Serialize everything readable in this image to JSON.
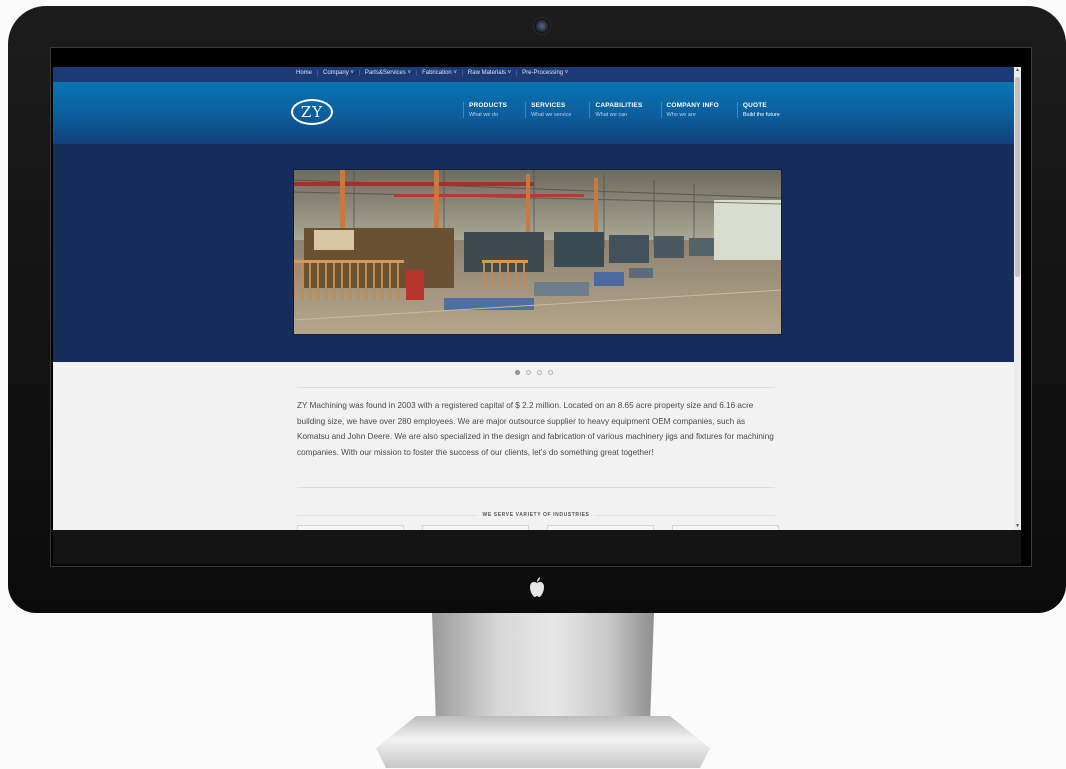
{
  "utility_nav": {
    "items": [
      "Home",
      "Company ˅",
      "Parts&Services ˅",
      "Fabrication ˅",
      "Raw Materials ˅",
      "Pre-Processing ˅"
    ]
  },
  "brand": {
    "logo_text": "ZY"
  },
  "main_nav": [
    {
      "title": "PRODUCTS",
      "subtitle": "What we do"
    },
    {
      "title": "SERVICES",
      "subtitle": "What we service"
    },
    {
      "title": "CAPABILITIES",
      "subtitle": "What we can"
    },
    {
      "title": "COMPANY INFO",
      "subtitle": "Who we are"
    },
    {
      "title": "QUOTE",
      "subtitle": "Build the future"
    }
  ],
  "slider": {
    "slide_count": 4,
    "active_index": 0
  },
  "intro": {
    "text": "ZY Machining was found in 2003 with a registered capital of $ 2.2 million. Located on an 8.65 acre property size and 6.16 acre building size, we have over 280 employees. We are major outsource supplier to heavy equipment OEM companies, such as Komatsu and John Deere. We are also specialized in the design and fabrication of various machinery jigs and fixtures for machining companies. With our mission to foster the success of our clients, let's do something great together!"
  },
  "industries": {
    "heading": "WE SERVE VARIETY OF INDUSTRIES"
  },
  "colors": {
    "topbar": "#1b3a76",
    "header_top": "#0a75b4",
    "hero_bg": "#162d5b",
    "content_bg": "#f2f2f2"
  },
  "icons": {
    "device_logo": "apple-logo-icon",
    "camera": "camera-icon"
  }
}
